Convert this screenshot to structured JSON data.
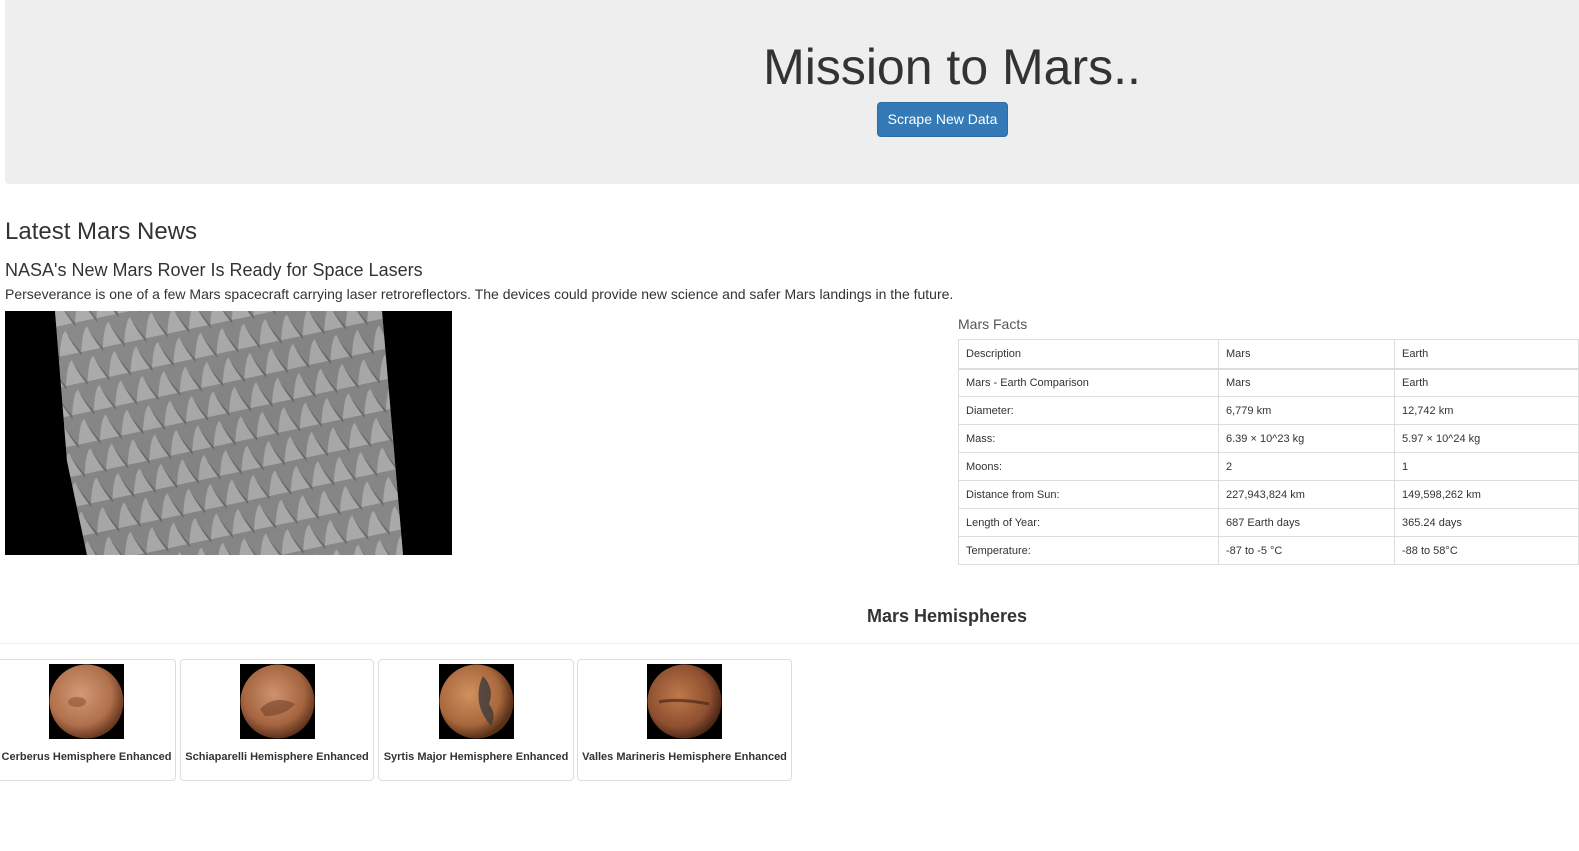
{
  "header": {
    "title": "Mission to Mars..",
    "scrape_button_label": "Scrape New Data",
    "button_color": "#337ab7"
  },
  "news": {
    "section_heading": "Latest Mars News",
    "title": "NASA's New Mars Rover Is Ready for Space Lasers",
    "teaser": "Perseverance is one of a few Mars spacecraft carrying laser retroreflectors. The devices could provide new science and safer Mars landings in the future.",
    "featured_image": "mars-sand-dunes-image"
  },
  "facts": {
    "caption": "Mars Facts",
    "columns": [
      "Description",
      "Mars",
      "Earth"
    ],
    "rows": [
      [
        "Mars - Earth Comparison",
        "Mars",
        "Earth"
      ],
      [
        "Diameter:",
        "6,779 km",
        "12,742 km"
      ],
      [
        "Mass:",
        "6.39 × 10^23 kg",
        "5.97 × 10^24 kg"
      ],
      [
        "Moons:",
        "2",
        "1"
      ],
      [
        "Distance from Sun:",
        "227,943,824 km",
        "149,598,262 km"
      ],
      [
        "Length of Year:",
        "687 Earth days",
        "365.24 days"
      ],
      [
        "Temperature:",
        "-87 to -5 °C",
        "-88 to 58°C"
      ]
    ]
  },
  "hemispheres": {
    "heading": "Mars Hemispheres",
    "items": [
      {
        "title": "Cerberus Hemisphere Enhanced",
        "image": "cerberus-hemisphere-image"
      },
      {
        "title": "Schiaparelli Hemisphere Enhanced",
        "image": "schiaparelli-hemisphere-image"
      },
      {
        "title": "Syrtis Major Hemisphere Enhanced",
        "image": "syrtis-major-hemisphere-image"
      },
      {
        "title": "Valles Marineris Hemisphere Enhanced",
        "image": "valles-marineris-hemisphere-image"
      }
    ]
  }
}
